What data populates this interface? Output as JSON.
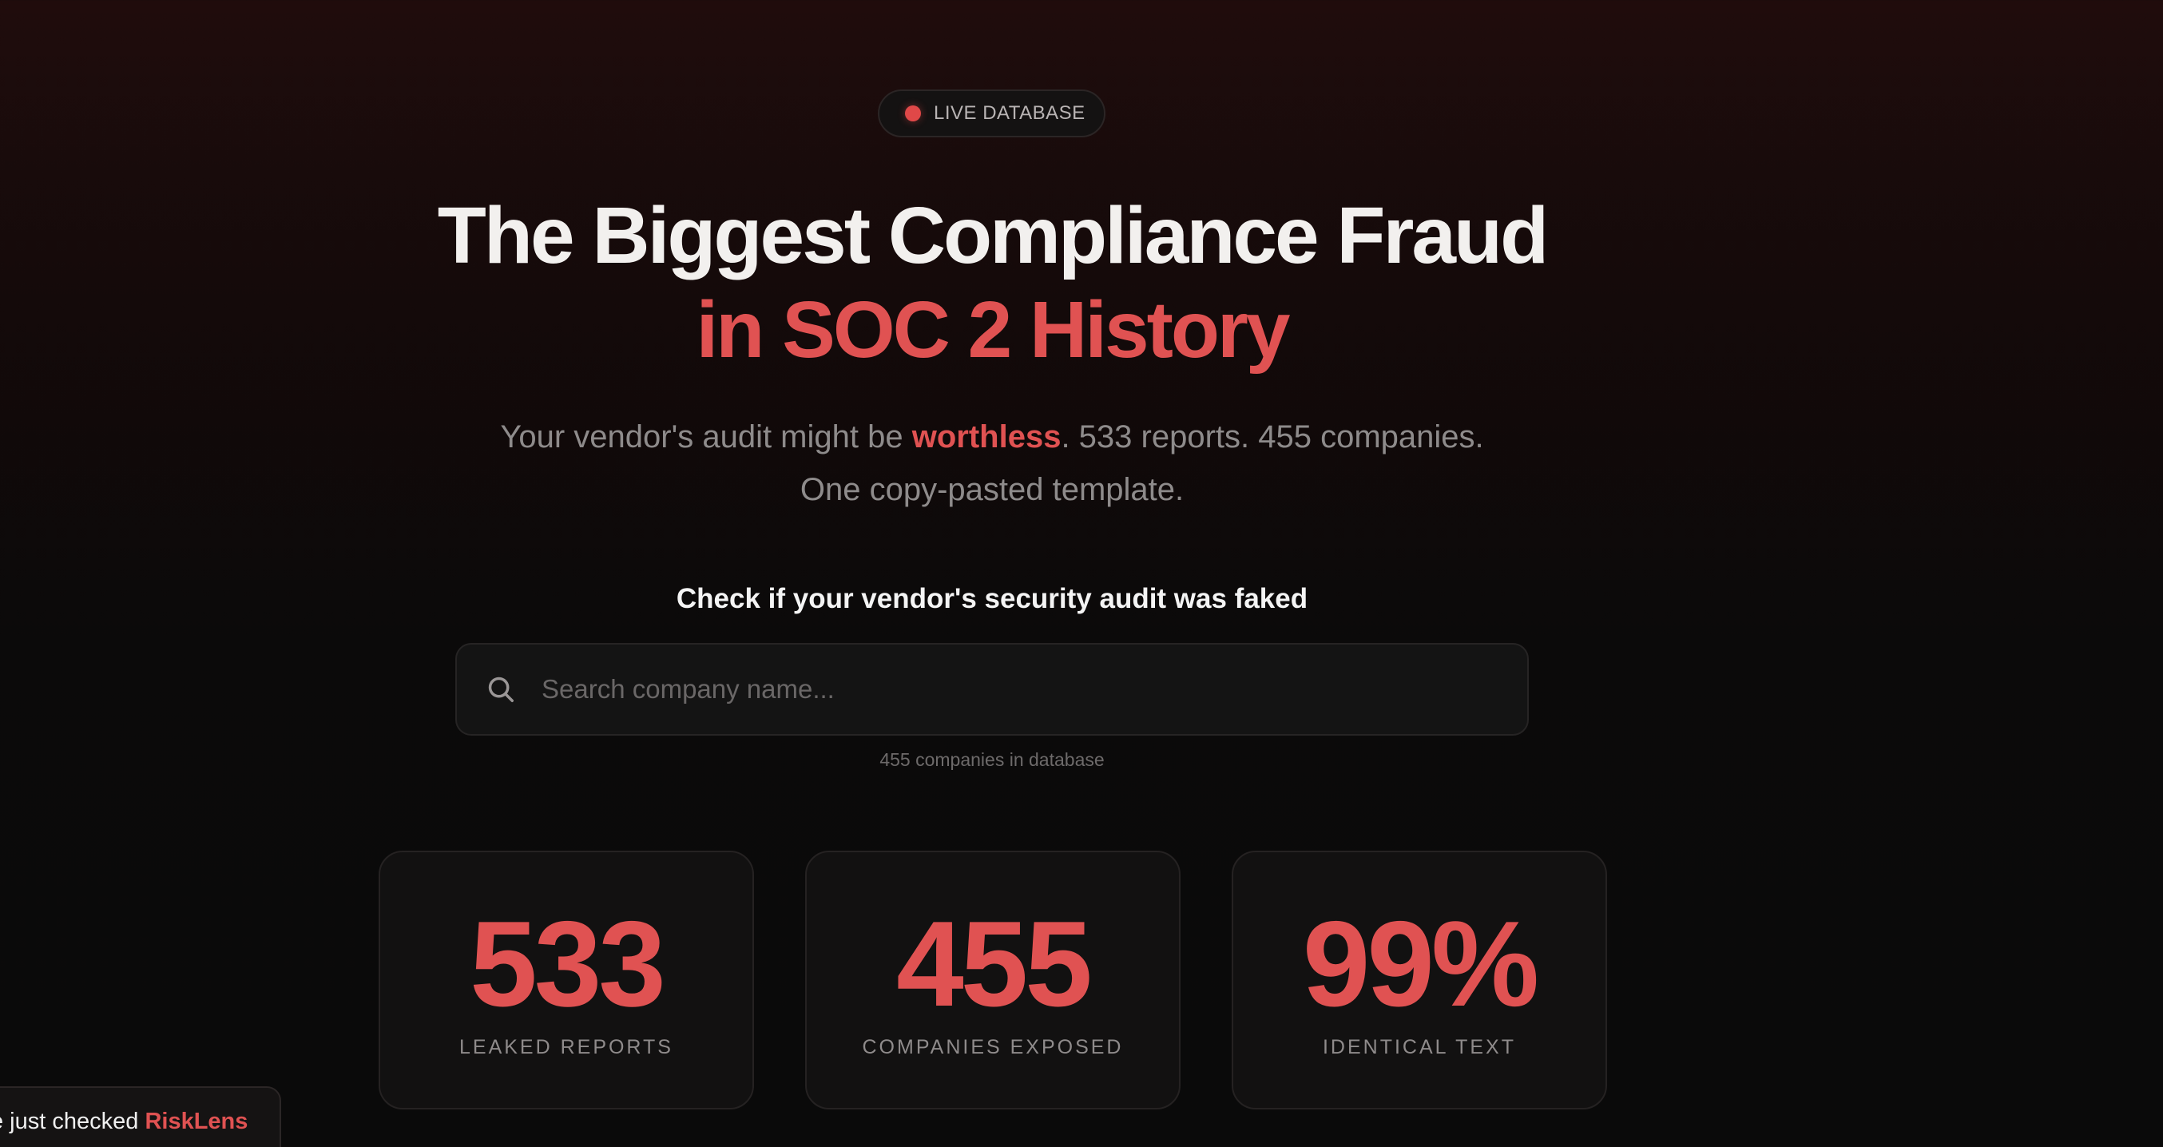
{
  "badge": {
    "label": "LIVE DATABASE"
  },
  "headline": {
    "line1": "The Biggest Compliance Fraud",
    "line2": "in SOC 2 History"
  },
  "subheadline": {
    "before_highlight": "Your vendor's audit might be ",
    "highlight": "worthless",
    "after_highlight": ". 533 reports. 455 companies.",
    "line2": "One copy-pasted template."
  },
  "search": {
    "heading": "Check if your vendor's security audit was faked",
    "placeholder": "Search company name...",
    "value": "",
    "icon": "search-icon",
    "database_count": "455 companies in database"
  },
  "stats": [
    {
      "value": "533",
      "label": "LEAKED REPORTS"
    },
    {
      "value": "455",
      "label": "COMPANIES EXPOSED"
    },
    {
      "value": "99%",
      "label": "IDENTICAL TEXT"
    }
  ],
  "toast": {
    "text": "e just checked ",
    "company": "RiskLens"
  },
  "colors": {
    "accent": "#e05252",
    "background": "#0a0a0a",
    "card": "#121111"
  }
}
